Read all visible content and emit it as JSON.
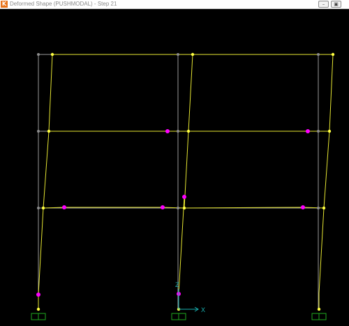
{
  "window": {
    "title": "Deformed Shape (PUSHMODAL) - Step 21",
    "app_icon_glyph": "K",
    "minimize_glyph": "–",
    "restore_glyph": "▣"
  },
  "viewport": {
    "axis_x_label": "X",
    "axis_z_label": "Z",
    "background_color": "#000000",
    "undeformed_color": "#9a9a9a",
    "deformed_color": "#e6e632",
    "joint_color": "#ffff40",
    "hinge_color": "#ff00ff",
    "support_color": "#1faa1f",
    "axis_color": "#19b2b2"
  }
}
